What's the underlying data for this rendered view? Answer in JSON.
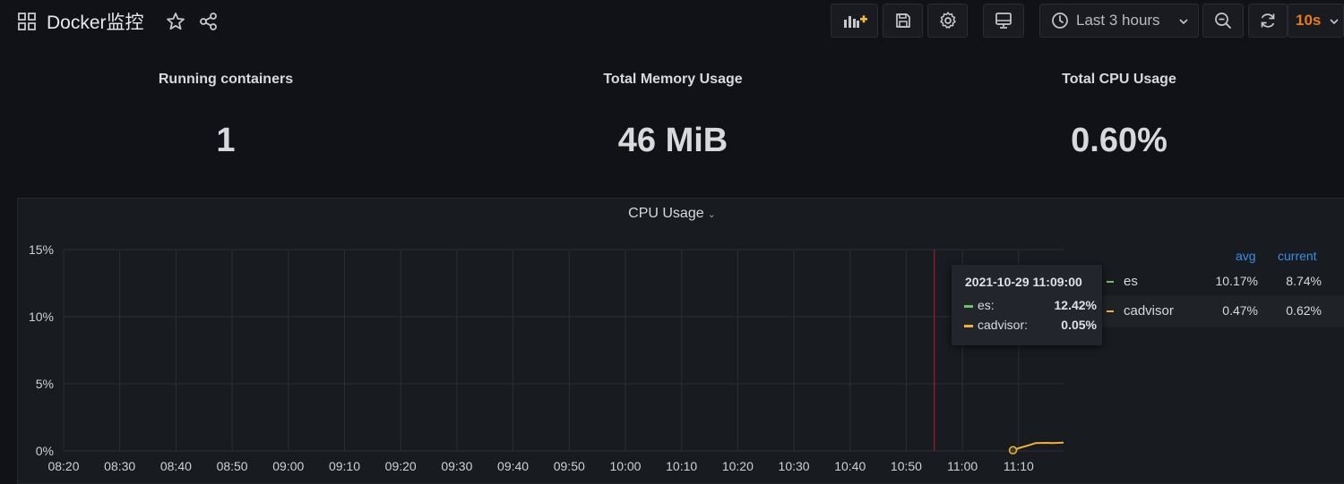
{
  "dashboard": {
    "title": "Docker监控"
  },
  "toolbar": {
    "time_range": "Last 3 hours",
    "refresh_interval": "10s"
  },
  "stats": [
    {
      "title": "Running containers",
      "value": "1"
    },
    {
      "title": "Total Memory Usage",
      "value": "46 MiB"
    },
    {
      "title": "Total CPU Usage",
      "value": "0.60%"
    }
  ],
  "graph": {
    "title": "CPU Usage",
    "legend_headers": {
      "avg": "avg",
      "current": "current"
    },
    "legend": [
      {
        "name": "es",
        "avg": "10.17%",
        "current": "8.74%",
        "color": "#73bf69"
      },
      {
        "name": "cadvisor",
        "avg": "0.47%",
        "current": "0.62%",
        "color": "#f2b133"
      }
    ],
    "tooltip": {
      "time": "2021-10-29 11:09:00",
      "rows": [
        {
          "name": "es:",
          "value": "12.42%",
          "color": "#73bf69"
        },
        {
          "name": "cadvisor:",
          "value": "0.05%",
          "color": "#f2b133"
        }
      ]
    }
  },
  "colors": {
    "background": "#111217",
    "panel": "#181b1f",
    "accent_orange": "#eb7b18",
    "legend_header_blue": "#3a8ee6",
    "crosshair": "#c4162a"
  },
  "chart_data": {
    "type": "line",
    "title": "CPU Usage",
    "xlabel": "",
    "ylabel": "",
    "x_ticks": [
      "08:20",
      "08:30",
      "08:40",
      "08:50",
      "09:00",
      "09:10",
      "09:20",
      "09:30",
      "09:40",
      "09:50",
      "10:00",
      "10:10",
      "10:20",
      "10:30",
      "10:40",
      "10:50",
      "11:00",
      "11:10"
    ],
    "y_ticks": [
      "0%",
      "5%",
      "10%",
      "15%"
    ],
    "ylim": [
      0,
      15
    ],
    "xlim": [
      "08:20",
      "11:18"
    ],
    "grid": true,
    "legend_position": "right",
    "crosshair_x": "10:55",
    "series": [
      {
        "name": "cadvisor",
        "color": "#f2b133",
        "points": [
          [
            "11:09",
            0.05
          ],
          [
            "11:10",
            0.2
          ],
          [
            "11:12",
            0.45
          ],
          [
            "11:13",
            0.58
          ],
          [
            "11:15",
            0.6
          ],
          [
            "11:16",
            0.58
          ],
          [
            "11:18",
            0.62
          ]
        ]
      }
    ]
  }
}
